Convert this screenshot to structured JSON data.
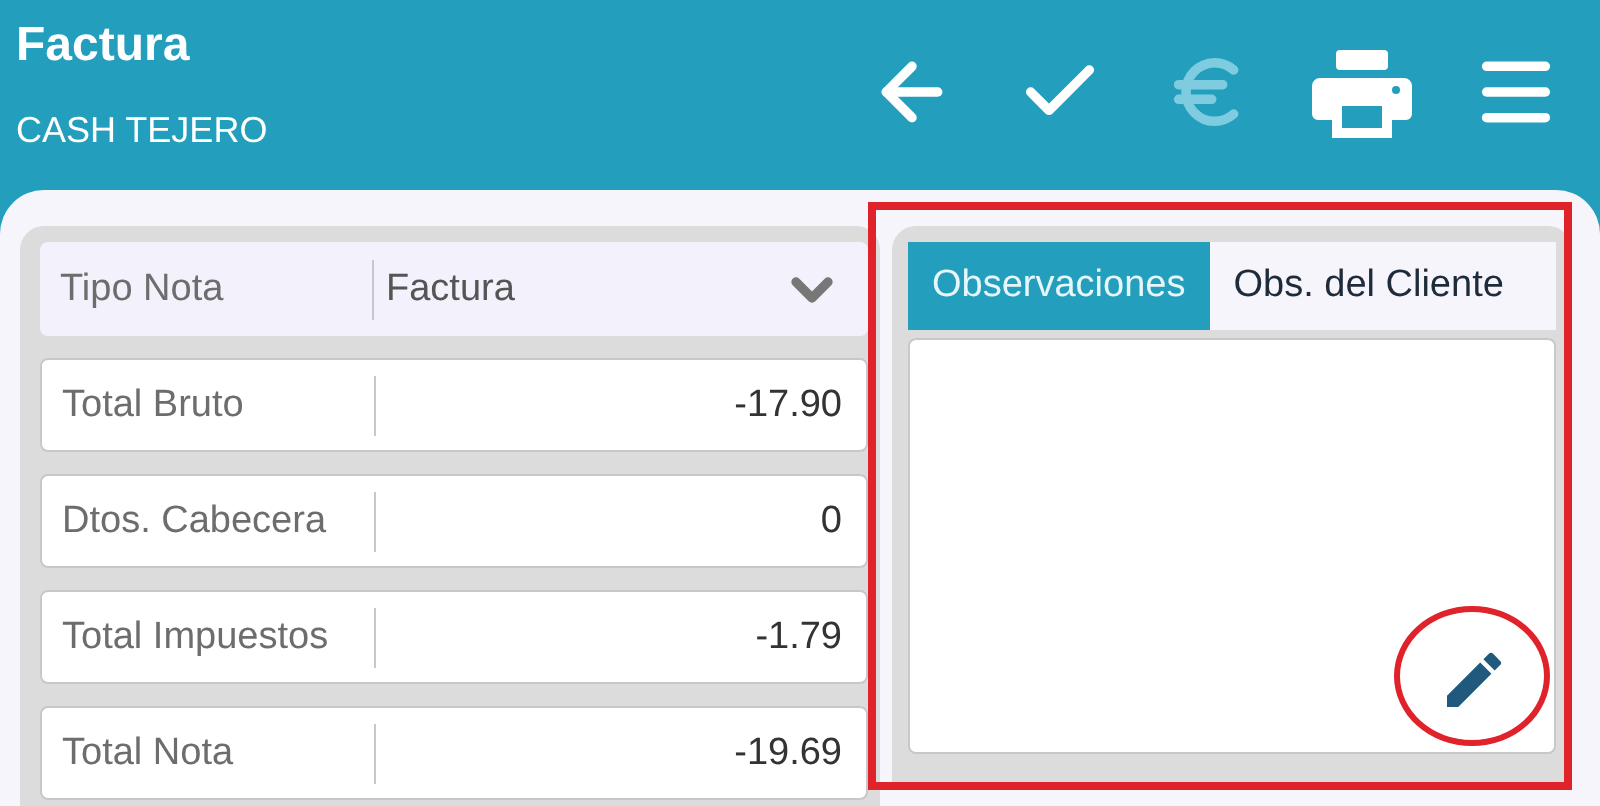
{
  "header": {
    "title": "Factura",
    "subtitle": "CASH TEJERO"
  },
  "toolbar": [
    {
      "kind": "back",
      "disabled": false
    },
    {
      "kind": "confirm",
      "disabled": false
    },
    {
      "kind": "euro",
      "disabled": true
    },
    {
      "kind": "print",
      "disabled": false
    },
    {
      "kind": "menu",
      "disabled": false
    }
  ],
  "note_type": {
    "label": "Tipo Nota",
    "value": "Factura"
  },
  "totals": [
    {
      "label": "Total Bruto",
      "value": "-17.90"
    },
    {
      "label": "Dtos. Cabecera",
      "value": "0"
    },
    {
      "label": "Total Impuestos",
      "value": "-1.79"
    },
    {
      "label": "Total Nota",
      "value": "-19.69"
    }
  ],
  "tabs": [
    {
      "label": "Observaciones",
      "selected": true
    },
    {
      "label": "Obs. del Cliente",
      "selected": false
    }
  ],
  "annotations": [
    {
      "kind": "rectangle",
      "color": "#e0222b"
    },
    {
      "kind": "circle",
      "color": "#e0222b"
    }
  ]
}
